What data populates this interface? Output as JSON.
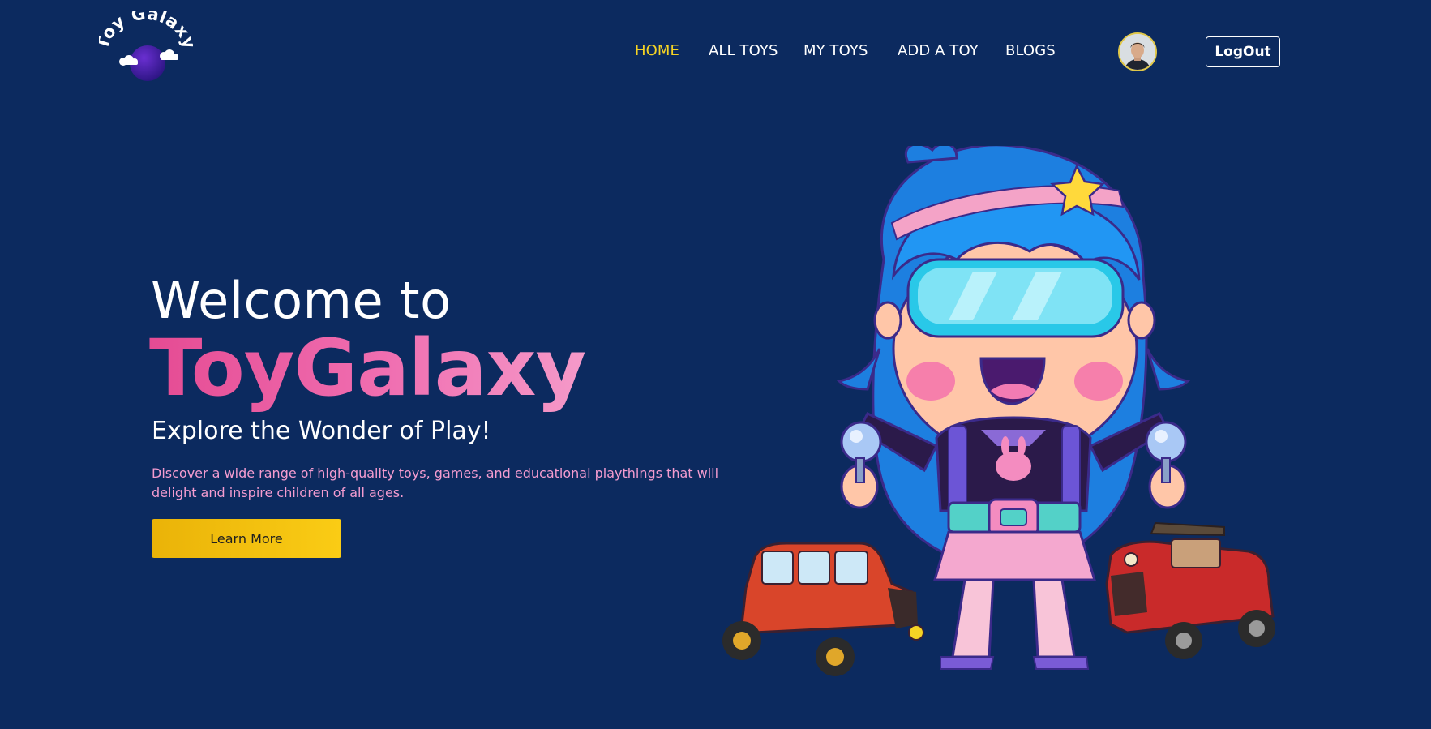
{
  "header": {
    "logo_text": "Toy Galaxy",
    "nav": [
      {
        "label": "HOME",
        "active": true
      },
      {
        "label": "ALL TOYS",
        "active": false
      },
      {
        "label": "MY TOYS",
        "active": false
      },
      {
        "label": "ADD A TOY",
        "active": false
      },
      {
        "label": "BLOGS",
        "active": false
      }
    ],
    "logout_label": "LogOut"
  },
  "hero": {
    "welcome": "Welcome to",
    "brand": "ToyGalaxy",
    "tagline": "Explore the Wonder of Play!",
    "description": "Discover a wide range of high-quality toys, games, and educational playthings that will delight and inspire children of all ages.",
    "cta_label": "Learn More"
  },
  "colors": {
    "background": "#0c2a5f",
    "nav_active": "#f5d324",
    "brand_gradient_start": "#e54b93",
    "brand_gradient_end": "#f59ac9",
    "description": "#f49cd0",
    "cta": "#facc15"
  },
  "icons": {
    "logo": "planet-logo-icon",
    "avatar": "user-avatar",
    "illustration": "toy-girl-with-cars-illustration"
  }
}
